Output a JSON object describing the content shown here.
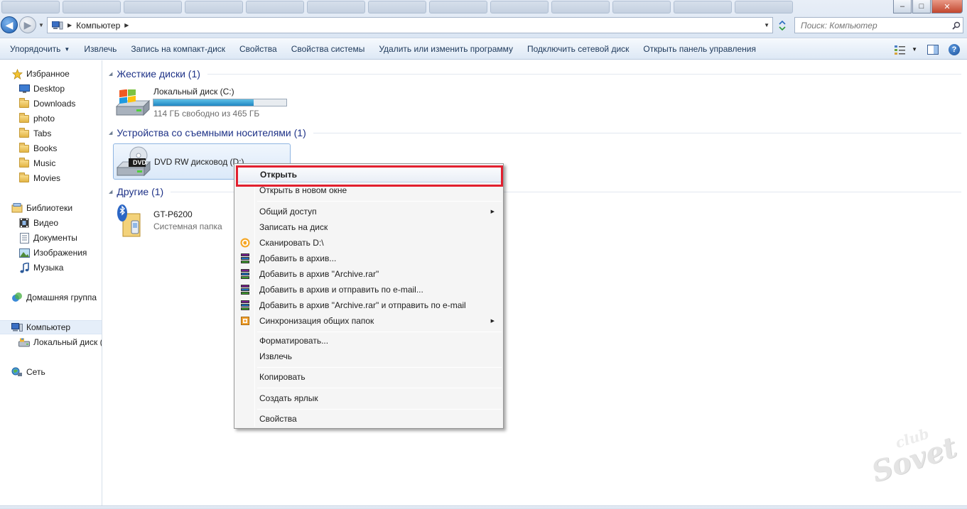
{
  "address": {
    "crumb": "Компьютер",
    "search_placeholder": "Поиск: Компьютер"
  },
  "toolbar": {
    "organize": "Упорядочить",
    "eject": "Извлечь",
    "burn": "Запись на компакт-диск",
    "properties": "Свойства",
    "system_properties": "Свойства системы",
    "uninstall": "Удалить или изменить программу",
    "map_drive": "Подключить сетевой диск",
    "control_panel": "Открыть панель управления"
  },
  "nav": {
    "favorites": "Избранное",
    "desktop": "Desktop",
    "downloads": "Downloads",
    "photo": "photo",
    "tabs": "Tabs",
    "books": "Books",
    "music": "Music",
    "movies": "Movies",
    "libraries": "Библиотеки",
    "video": "Видео",
    "documents": "Документы",
    "images": "Изображения",
    "music_lib": "Музыка",
    "homegroup": "Домашняя группа",
    "computer": "Компьютер",
    "local_disk": "Локальный диск (",
    "network": "Сеть"
  },
  "content": {
    "hard_disks_header": "Жесткие диски (1)",
    "local_disk_name": "Локальный диск (C:)",
    "local_disk_free": "114 ГБ свободно из 465 ГБ",
    "local_disk_used_fraction": 0.755,
    "removable_header": "Устройства со съемными носителями (1)",
    "dvd_name": "DVD RW дисковод (D:)",
    "dvd_icon_label": "DVD",
    "other_header": "Другие (1)",
    "phone_name": "GT-P6200",
    "phone_type": "Системная папка"
  },
  "context_menu": {
    "open": "Открыть",
    "open_new_window": "Открыть в новом окне",
    "share": "Общий доступ",
    "burn": "Записать на диск",
    "scan": "Сканировать D:\\",
    "add_archive": "Добавить в архив...",
    "add_archive_rar": "Добавить в архив \"Archive.rar\"",
    "add_archive_email": "Добавить в архив и отправить по e-mail...",
    "add_archive_rar_email": "Добавить в архив \"Archive.rar\" и отправить по e-mail",
    "sync": "Синхронизация общих папок",
    "format": "Форматировать...",
    "eject": "Извлечь",
    "copy": "Копировать",
    "shortcut": "Создать ярлык",
    "properties": "Свойства"
  },
  "watermark": {
    "line1": "club",
    "line2": "Sovet"
  }
}
